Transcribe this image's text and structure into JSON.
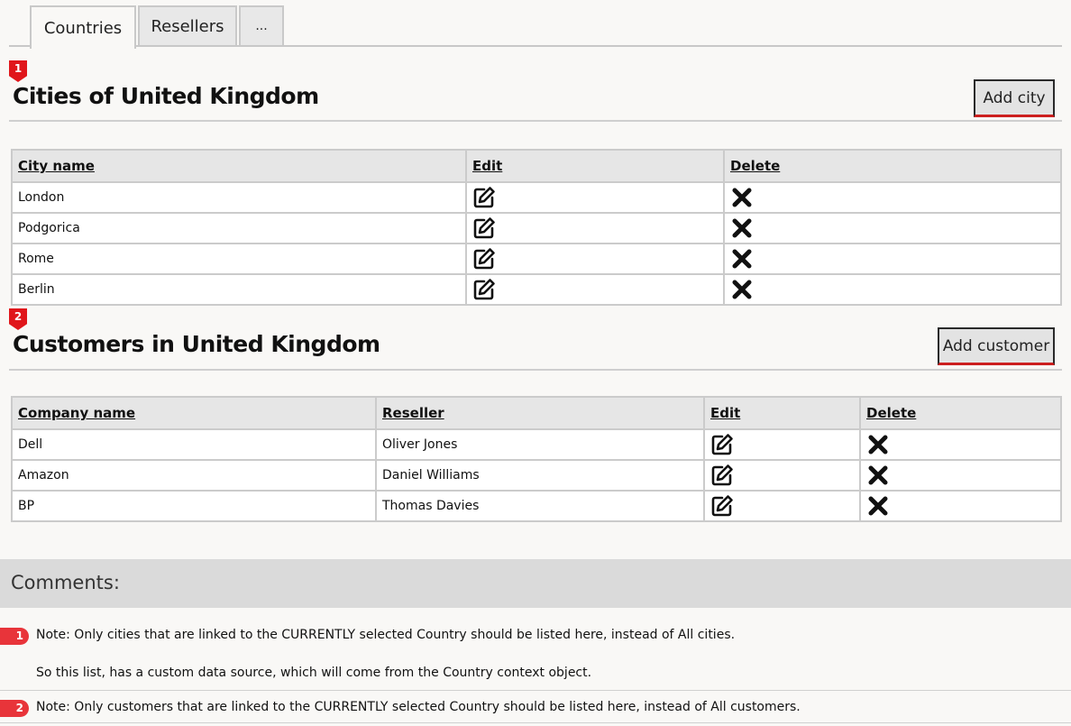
{
  "tabs": [
    {
      "label": "Countries",
      "active": true
    },
    {
      "label": "Resellers",
      "active": false
    },
    {
      "label": "...",
      "active": false
    }
  ],
  "markers": {
    "cities": "1",
    "customers": "2"
  },
  "cities_section": {
    "title": "Cities of United Kingdom",
    "add_label": "Add city",
    "columns": [
      "City name",
      "Edit",
      "Delete"
    ],
    "rows": [
      "London",
      "Podgorica",
      "Rome",
      "Berlin"
    ]
  },
  "customers_section": {
    "title": "Customers in United Kingdom",
    "add_label": "Add customer",
    "columns": [
      "Company name",
      "Reseller",
      "Edit",
      "Delete"
    ],
    "rows": [
      {
        "company": "Dell",
        "reseller": "Oliver Jones"
      },
      {
        "company": "Amazon",
        "reseller": "Daniel Williams"
      },
      {
        "company": "BP",
        "reseller": "Thomas Davies"
      }
    ]
  },
  "comments": {
    "title": "Comments:",
    "items": [
      {
        "badge": "1",
        "text": "Note: Only cities that are linked to the CURRENTLY selected Country should be listed here, instead of All cities."
      },
      {
        "badge": "",
        "text": "So this list, has a custom data source, which will come from the Country context object."
      },
      {
        "badge": "2",
        "text": "Note: Only customers that are linked to the CURRENTLY selected Country should be listed here, instead of All customers."
      }
    ]
  },
  "icons": {
    "edit": "edit-pencil-icon",
    "delete": "delete-x-icon"
  },
  "colors": {
    "marker": "#e0161b",
    "button_underline": "#cc1f1f",
    "header_bg": "#e6e6e6",
    "comments_bg": "#dadada"
  }
}
